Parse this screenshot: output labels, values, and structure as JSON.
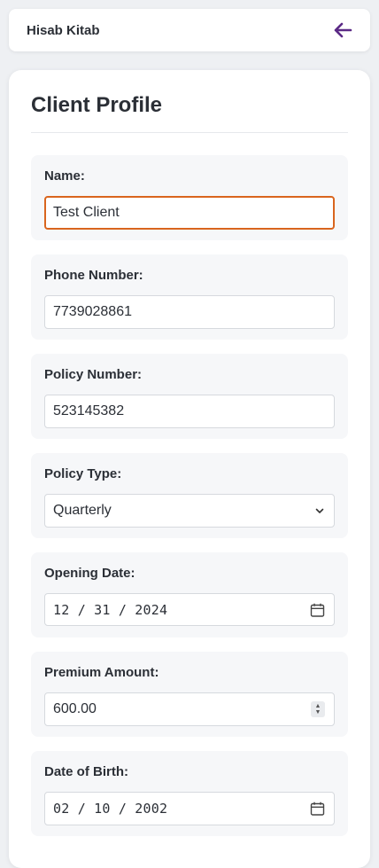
{
  "header": {
    "brand": "Hisab Kitab",
    "back_icon": "arrow-left-icon",
    "accent": "#5b2a86"
  },
  "page": {
    "title": "Client Profile"
  },
  "fields": {
    "name": {
      "label": "Name:",
      "value": "Test Client"
    },
    "phone": {
      "label": "Phone Number:",
      "value": "7739028861"
    },
    "policy_number": {
      "label": "Policy Number:",
      "value": "523145382"
    },
    "policy_type": {
      "label": "Policy Type:",
      "value": "Quarterly"
    },
    "opening_date": {
      "label": "Opening Date:",
      "value": "12 / 31 / 2024"
    },
    "premium": {
      "label": "Premium Amount:",
      "value": "600.00"
    },
    "dob": {
      "label": "Date of Birth:",
      "value": "02 / 10 / 2002"
    }
  },
  "colors": {
    "focus_border": "#d9651e",
    "field_bg": "#f6f7f9"
  }
}
